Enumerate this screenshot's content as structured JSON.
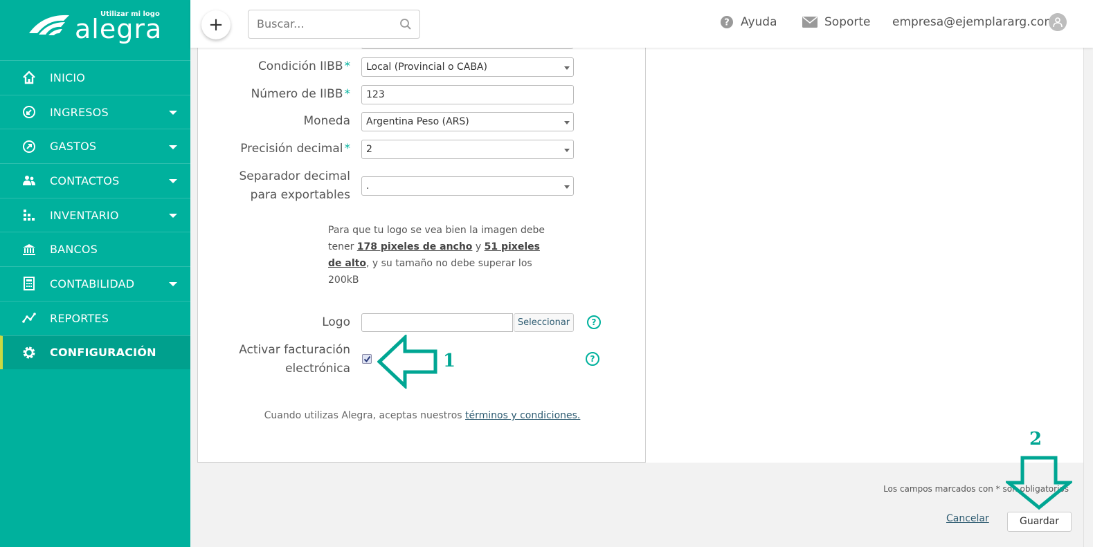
{
  "brand": {
    "caption": "Utilizar mi logo",
    "name": "alegra"
  },
  "sidebar": {
    "items": [
      {
        "label": "INICIO",
        "icon": "home-icon",
        "has_submenu": false
      },
      {
        "label": "INGRESOS",
        "icon": "income-icon",
        "has_submenu": true
      },
      {
        "label": "GASTOS",
        "icon": "expenses-icon",
        "has_submenu": true
      },
      {
        "label": "CONTACTOS",
        "icon": "contacts-icon",
        "has_submenu": true
      },
      {
        "label": "INVENTARIO",
        "icon": "inventory-icon",
        "has_submenu": true
      },
      {
        "label": "BANCOS",
        "icon": "bank-icon",
        "has_submenu": false
      },
      {
        "label": "CONTABILIDAD",
        "icon": "accounting-icon",
        "has_submenu": true
      },
      {
        "label": "REPORTES",
        "icon": "reports-icon",
        "has_submenu": false
      },
      {
        "label": "CONFIGURACIÓN",
        "icon": "gear-icon",
        "has_submenu": false,
        "active": true
      }
    ]
  },
  "header": {
    "add_label": "+",
    "search_placeholder": "Buscar...",
    "help_label": "Ayuda",
    "support_label": "Soporte",
    "user_email": "empresa@ejemplararg.com"
  },
  "form": {
    "iibb_condition": {
      "label": "Condición IIBB",
      "required": "*",
      "value": "Local (Provincial o CABA)"
    },
    "iibb_number": {
      "label": "Número de IIBB",
      "required": "*",
      "value": "123"
    },
    "currency": {
      "label": "Moneda",
      "value": "Argentina Peso (ARS)"
    },
    "decimal_precision": {
      "label": "Precisión decimal",
      "required": "*",
      "value": "2"
    },
    "decimal_separator": {
      "label_line1": "Separador decimal",
      "label_line2": "para exportables",
      "value": "."
    },
    "logo_note": {
      "part1": "Para que tu logo se vea bien la imagen debe tener ",
      "width_text": "178 pixeles de ancho",
      "part2": " y ",
      "height_text": "51 pixeles de alto",
      "part3": ", y su tamaño no debe superar los 200kB"
    },
    "logo": {
      "label": "Logo",
      "button": "Seleccionar",
      "help": "?"
    },
    "e_invoice": {
      "label_line1": "Activar facturación",
      "label_line2": "electrónica",
      "checked": true,
      "help": "?"
    },
    "terms": {
      "text": "Cuando utilizas Alegra, aceptas nuestros ",
      "link": "términos y condiciones."
    }
  },
  "footer": {
    "required_note": "Los campos marcados con * son obligatorios",
    "cancel_label": "Cancelar",
    "save_label": "Guardar"
  },
  "annotations": {
    "step1": "1",
    "step2": "2"
  },
  "colors": {
    "brand": "#00b19d",
    "active_item": "#00a08d",
    "active_marker": "#c9d943"
  }
}
